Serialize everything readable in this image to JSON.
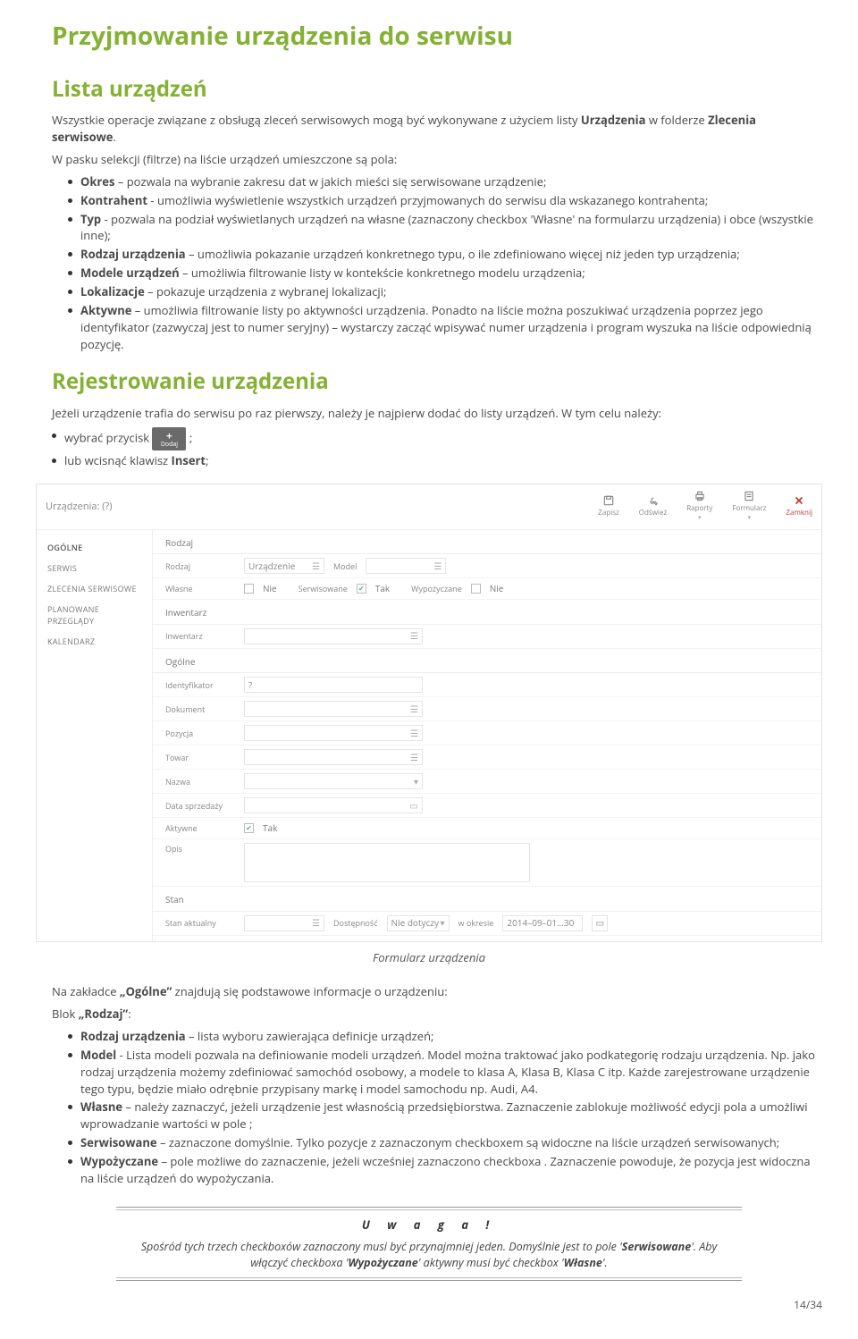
{
  "page_title": "Przyjmowanie urządzenia do serwisu",
  "section1": {
    "title": "Lista urządzeń",
    "intro_pre": "Wszystkie operacje związane z obsługą zleceń serwisowych mogą być wykonywane z użyciem listy ",
    "intro_bold1": "Urządzenia",
    "intro_mid": " w folderze ",
    "intro_bold2": "Zlecenia serwisowe",
    "intro_post": ".",
    "lead2": "W pasku selekcji (filtrze) na liście urządzeń umieszczone są pola:",
    "items": [
      {
        "b": "Okres",
        "t": " – pozwala na wybranie zakresu dat w jakich mieści się serwisowane urządzenie;"
      },
      {
        "b": "Kontrahent",
        "t": " - umożliwia wyświetlenie wszystkich urządzeń przyjmowanych do serwisu dla wskazanego kontrahenta;"
      },
      {
        "b": "Typ",
        "t": " - pozwala na podział wyświetlanych urządzeń na własne (zaznaczony checkbox 'Własne' na formularzu urządzenia) i obce (wszystkie inne);"
      },
      {
        "b": "Rodzaj urządzenia",
        "t": " – umożliwia pokazanie urządzeń konkretnego typu, o ile zdefiniowano więcej niż jeden typ urządzenia;"
      },
      {
        "b": "Modele urządzeń",
        "t": " – umożliwia filtrowanie listy w kontekście konkretnego modelu urządzenia;"
      },
      {
        "b": "Lokalizacje",
        "t": " – pokazuje urządzenia z wybranej lokalizacji;"
      },
      {
        "b": "Aktywne",
        "t": " – umożliwia filtrowanie listy po aktywności urządzenia. Ponadto na liście można poszukiwać urządzenia poprzez jego identyfikator (zazwyczaj jest to numer seryjny) – wystarczy zacząć wpisywać numer urządzenia i program wyszuka na liście odpowiednią pozycję."
      }
    ]
  },
  "section2": {
    "title": "Rejestrowanie urządzenia",
    "lead": "Jeżeli urządzenie trafia do serwisu po raz pierwszy, należy je najpierw dodać do listy urządzeń. W tym celu należy:",
    "btn_label": "Dodaj",
    "items": [
      {
        "pre": "wybrać przycisk ",
        "btn": true,
        "post": " ;"
      },
      {
        "pre": "lub wcisnąć klawisz ",
        "bold": "Insert",
        "post": ";"
      }
    ]
  },
  "form": {
    "header_title": "Urządzenia: (?)",
    "tools": {
      "save": "Zapisz",
      "refresh": "Odśwież",
      "reports": "Raporty",
      "lists": "Formularz",
      "close": "Zamknij"
    },
    "sidebar": [
      "OGÓLNE",
      "SERWIS",
      "ZLECENIA SERWISOWE",
      "PLANOWANE PRZEGLĄDY",
      "KALENDARZ"
    ],
    "g1_title": "Rodzaj",
    "g1_rodzaj": "Rodzaj",
    "g1_urzadzenie": "Urządzenie",
    "g1_model": "Model",
    "g1_wlasne": "Własne",
    "g1_wlasne_val": "Nie",
    "g1_serwisowane": "Serwisowane",
    "g1_serwisowane_val": "Tak",
    "g1_wypozyczane": "Wypożyczane",
    "g1_wypozyczane_val": "Nie",
    "g2_title": "Inwentarz",
    "g2_inw": "Inwentarz",
    "g3_title": "Ogólne",
    "g3_ident": "Identyfikator",
    "g3_ident_val": "?",
    "g3_dok": "Dokument",
    "g3_poz": "Pozycja",
    "g3_towar": "Towar",
    "g3_nazwa": "Nazwa",
    "g3_data": "Data sprzedaży",
    "g3_aktywne": "Aktywne",
    "g3_aktywne_val": "Tak",
    "g3_opis": "Opis",
    "g4_title": "Stan",
    "g4_stan": "Stan aktualny",
    "g4_dost": "Dostępność",
    "g4_dost_val": "Nie dotyczy",
    "g4_okres": "w okresie",
    "g4_okres_val": "2014–09–01…30"
  },
  "caption": "Formularz urządzenia",
  "section3": {
    "lead_pre": "Na zakładce ",
    "lead_bold": "„Ogólne”",
    "lead_post": " znajdują się podstawowe informacje o urządzeniu:",
    "lead2_pre": "Blok ",
    "lead2_bold": "„Rodzaj”",
    "lead2_post": ":",
    "items": [
      {
        "b": "Rodzaj urządzenia",
        "t": " – lista wyboru zawierająca definicje urządzeń;"
      },
      {
        "b": "Model",
        "t": " - Lista modeli pozwala na definiowanie modeli urządzeń. Model można traktować jako podkategorię rodzaju urządzenia. Np. jako rodzaj urządzenia możemy zdefiniować samochód osobowy, a modele to klasa A, Klasa B, Klasa C itp. Każde zarejestrowane urządzenie tego typu, będzie miało odrębnie przypisany markę i model samochodu np. Audi, A4."
      },
      {
        "b": "Własne",
        "t": " – należy zaznaczyć, jeżeli urządzenie jest własnością przedsiębiorstwa. Zaznaczenie zablokuje możliwość edycji pola a umożliwi wprowadzanie wartości w pole ;"
      },
      {
        "b": "Serwisowane",
        "t": " – zaznaczone domyślnie. Tylko pozycje z zaznaczonym checkboxem są widoczne na liście urządzeń serwisowanych;"
      },
      {
        "b": "Wypożyczane",
        "t": " – pole możliwe do zaznaczenie, jeżeli wcześniej zaznaczono checkboxa . Zaznaczenie powoduje, że pozycja jest widoczna na liście urządzeń do wypożyczania."
      }
    ]
  },
  "warn": {
    "title": "U w a g a !",
    "body_pre": "Spośród tych trzech checkboxów zaznaczony musi być przynajmniej jeden. Domyślnie jest to pole '",
    "body_b1": "Serwisowane",
    "body_mid": "'. Aby włączyć checkboxa '",
    "body_b2": "Wypożyczane",
    "body_mid2": "' aktywny musi być checkbox '",
    "body_b3": "Własne",
    "body_post": "'."
  },
  "page_num": "14/34"
}
